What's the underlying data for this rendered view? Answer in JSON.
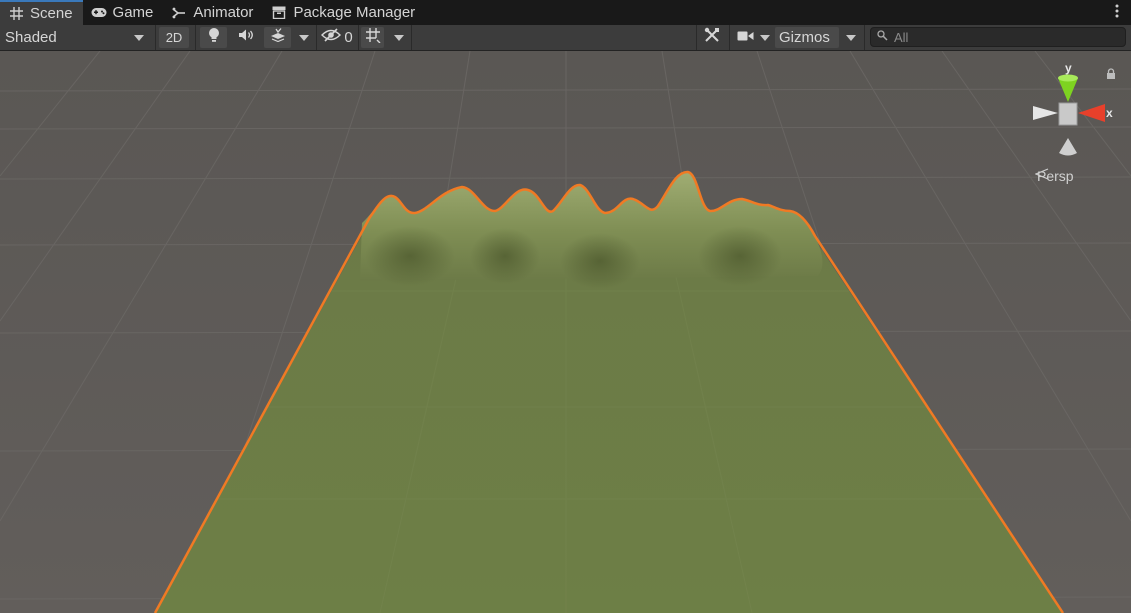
{
  "tabs": [
    {
      "label": "Scene",
      "icon": "grid-hash-icon",
      "active": true
    },
    {
      "label": "Game",
      "icon": "gamepad-icon",
      "active": false
    },
    {
      "label": "Animator",
      "icon": "animator-icon",
      "active": false
    },
    {
      "label": "Package Manager",
      "icon": "package-icon",
      "active": false
    }
  ],
  "toolbar": {
    "draw_mode": "Shaded",
    "mode_2d": "2D",
    "hidden_count": "0",
    "gizmos_label": "Gizmos",
    "search_placeholder": "All"
  },
  "scene_gizmo": {
    "y_label": "y",
    "x_label": "x",
    "projection": "Persp"
  },
  "colors": {
    "accent_tab": "#3a79bb",
    "selection_outline": "#f07a24",
    "terrain": "#6e7f47",
    "axis_y": "#7ed321",
    "axis_x": "#e8402b"
  }
}
